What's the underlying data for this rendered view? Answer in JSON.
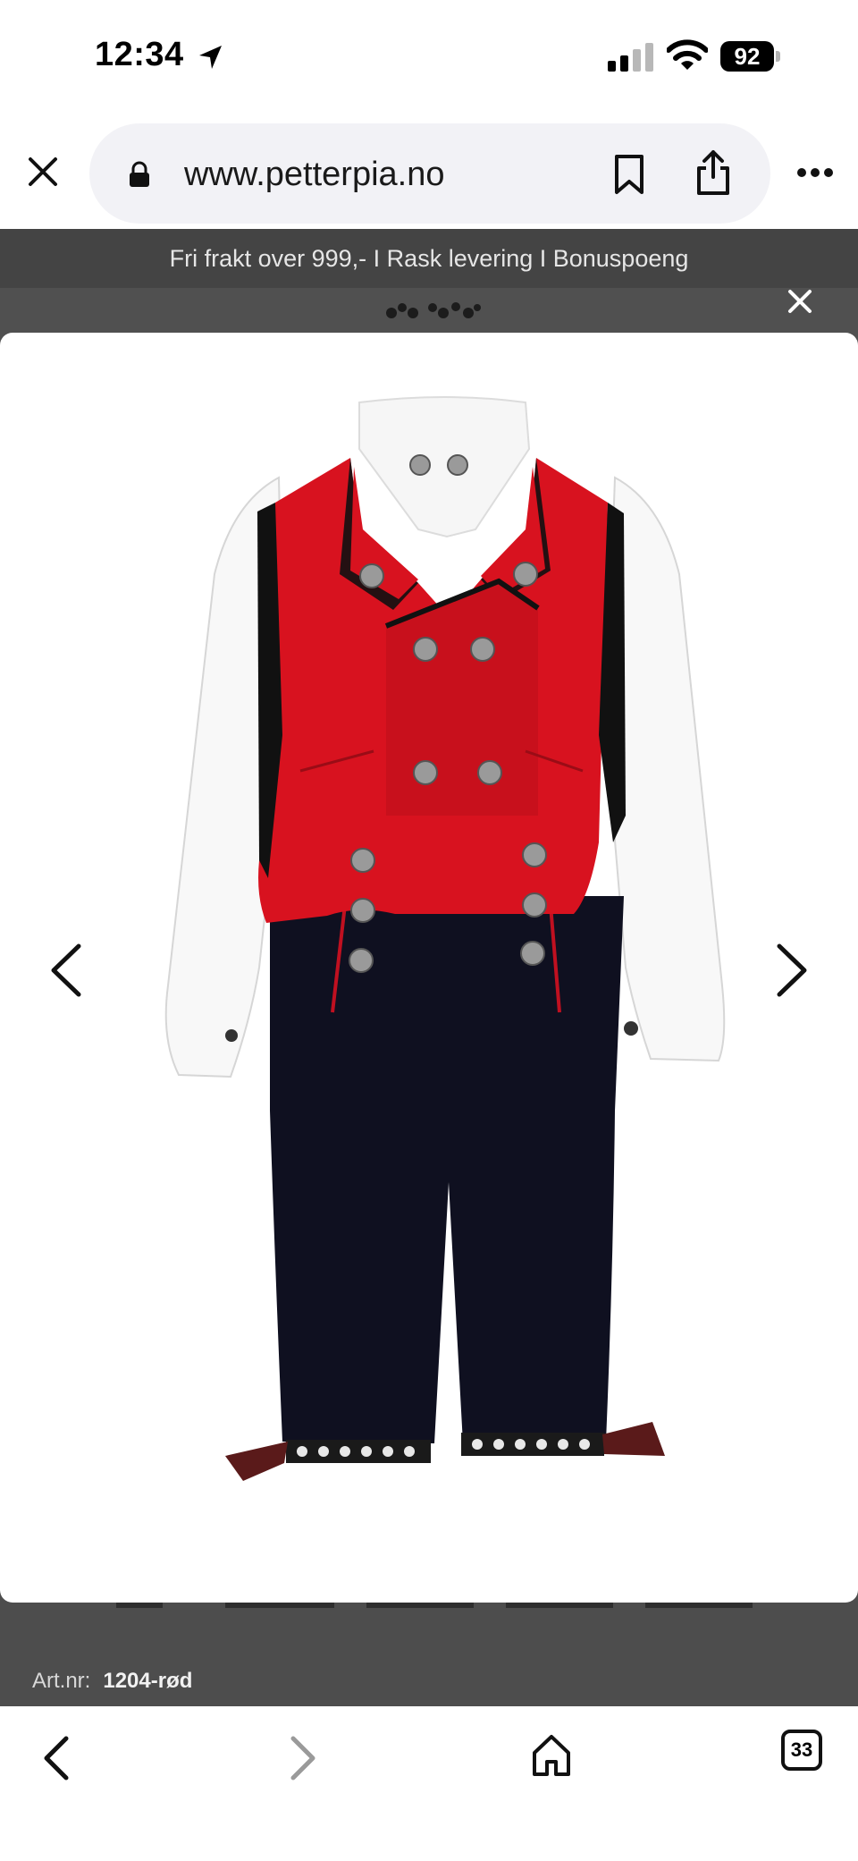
{
  "status_bar": {
    "time": "12:34",
    "battery": "92"
  },
  "browser": {
    "url": "www.petterpia.no"
  },
  "page": {
    "promo": "Fri frakt over 999,- I Rask levering I Bonuspoeng",
    "art_label": "Art.nr:",
    "art_number": "1204-rød"
  },
  "toolbar": {
    "tab_count": "33"
  },
  "colors": {
    "vest_red": "#d8121f",
    "dark_navy": "#0f1020",
    "overlay_gray": "#4d4d4d"
  }
}
